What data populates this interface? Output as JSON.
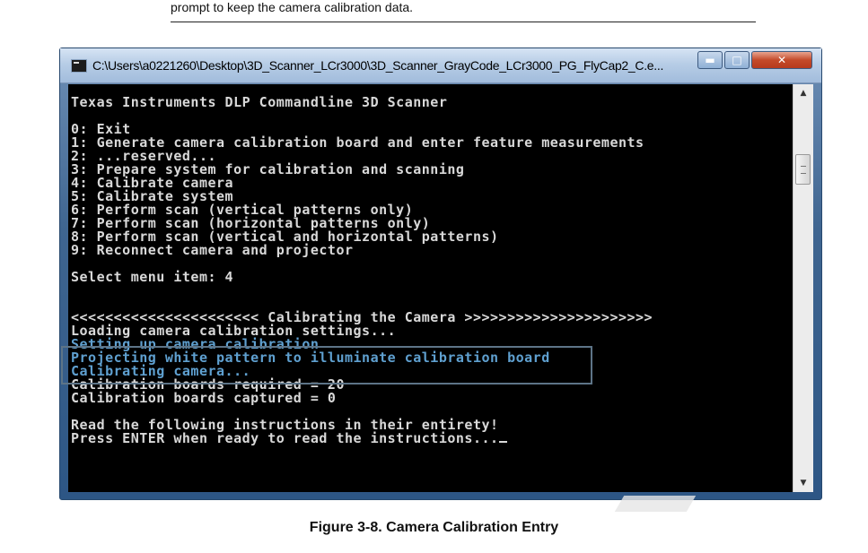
{
  "document": {
    "intro_text": "prompt to keep the camera calibration data.",
    "caption": "Figure 3-8. Camera Calibration Entry"
  },
  "window": {
    "title": "C:\\Users\\a0221260\\Desktop\\3D_Scanner_LCr3000\\3D_Scanner_GrayCode_LCr3000_PG_FlyCap2_C.e...",
    "minimize_glyph": "▬",
    "maximize_glyph": "□",
    "close_glyph": "✕"
  },
  "console": {
    "lines": [
      {
        "text": "Texas Instruments DLP Commandline 3D Scanner",
        "highlight": false
      },
      {
        "text": "",
        "highlight": false
      },
      {
        "text": "0: Exit",
        "highlight": false
      },
      {
        "text": "1: Generate camera calibration board and enter feature measurements",
        "highlight": false
      },
      {
        "text": "2: ...reserved...",
        "highlight": false
      },
      {
        "text": "3: Prepare system for calibration and scanning",
        "highlight": false
      },
      {
        "text": "4: Calibrate camera",
        "highlight": false
      },
      {
        "text": "5: Calibrate system",
        "highlight": false
      },
      {
        "text": "6: Perform scan (vertical patterns only)",
        "highlight": false
      },
      {
        "text": "7: Perform scan (horizontal patterns only)",
        "highlight": false
      },
      {
        "text": "8: Perform scan (vertical and horizontal patterns)",
        "highlight": false
      },
      {
        "text": "9: Reconnect camera and projector",
        "highlight": false
      },
      {
        "text": "",
        "highlight": false
      },
      {
        "text": "Select menu item: 4",
        "highlight": false
      },
      {
        "text": "",
        "highlight": false
      },
      {
        "text": "",
        "highlight": false
      },
      {
        "text": "<<<<<<<<<<<<<<<<<<<<<< Calibrating the Camera >>>>>>>>>>>>>>>>>>>>>>",
        "highlight": false
      },
      {
        "text": "Loading camera calibration settings...",
        "highlight": false
      },
      {
        "text": "Setting up camera calibration",
        "highlight": true
      },
      {
        "text": "Projecting white pattern to illuminate calibration board",
        "highlight": true
      },
      {
        "text": "Calibrating camera...",
        "highlight": true
      },
      {
        "text": "Calibration boards required = 20",
        "highlight": false
      },
      {
        "text": "Calibration boards captured = 0",
        "highlight": false
      },
      {
        "text": "",
        "highlight": false
      },
      {
        "text": "Read the following instructions in their entirety!",
        "highlight": false
      },
      {
        "text": "Press ENTER when ready to read the instructions...",
        "highlight": false,
        "cursor": true
      }
    ]
  },
  "scrollbar": {
    "up_arrow": "▲",
    "down_arrow": "▼"
  },
  "colors": {
    "console_text": "#d9d9d9",
    "highlight_text": "#5fa0d0",
    "console_bg": "#000000"
  }
}
